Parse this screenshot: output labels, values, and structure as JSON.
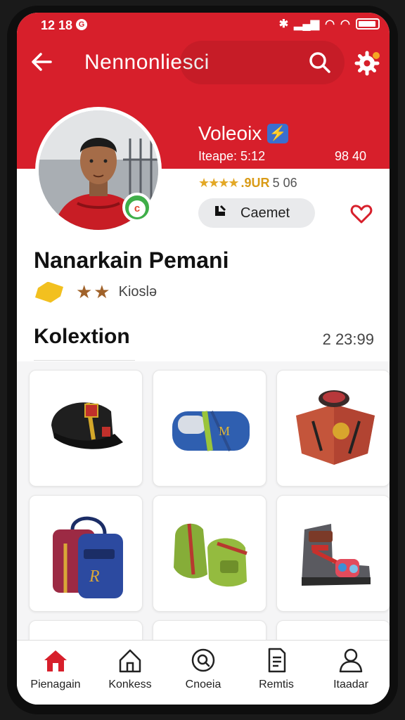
{
  "status": {
    "time": "12 18",
    "g_icon": "G"
  },
  "app_bar": {
    "title": "Nennonliesci",
    "back_icon": "arrow-left-icon",
    "search_icon": "search-icon",
    "settings_icon": "gear-icon"
  },
  "profile": {
    "display_name": "Voleoix",
    "meta_left": "Iteape: 5:12",
    "meta_right": "98 40",
    "stars": "★★★★",
    "rating": ".9UR",
    "rating_count": "5 06",
    "contact_label": "Caemet",
    "full_name": "Nanarkain Pemani",
    "achievement_label": "Kioslə"
  },
  "section": {
    "title": "Kolextion",
    "value": "2 23:99"
  },
  "nav": {
    "items": [
      {
        "label": "Pienagain",
        "icon": "home-icon"
      },
      {
        "label": "Konkess",
        "icon": "house-outline-icon"
      },
      {
        "label": "Cnoeia",
        "icon": "search-circle-icon"
      },
      {
        "label": "Remtis",
        "icon": "document-icon"
      },
      {
        "label": "Itaadar",
        "icon": "person-icon"
      }
    ]
  },
  "colors": {
    "brand_red": "#d71f2b",
    "nav_active": "#d71f2b"
  }
}
